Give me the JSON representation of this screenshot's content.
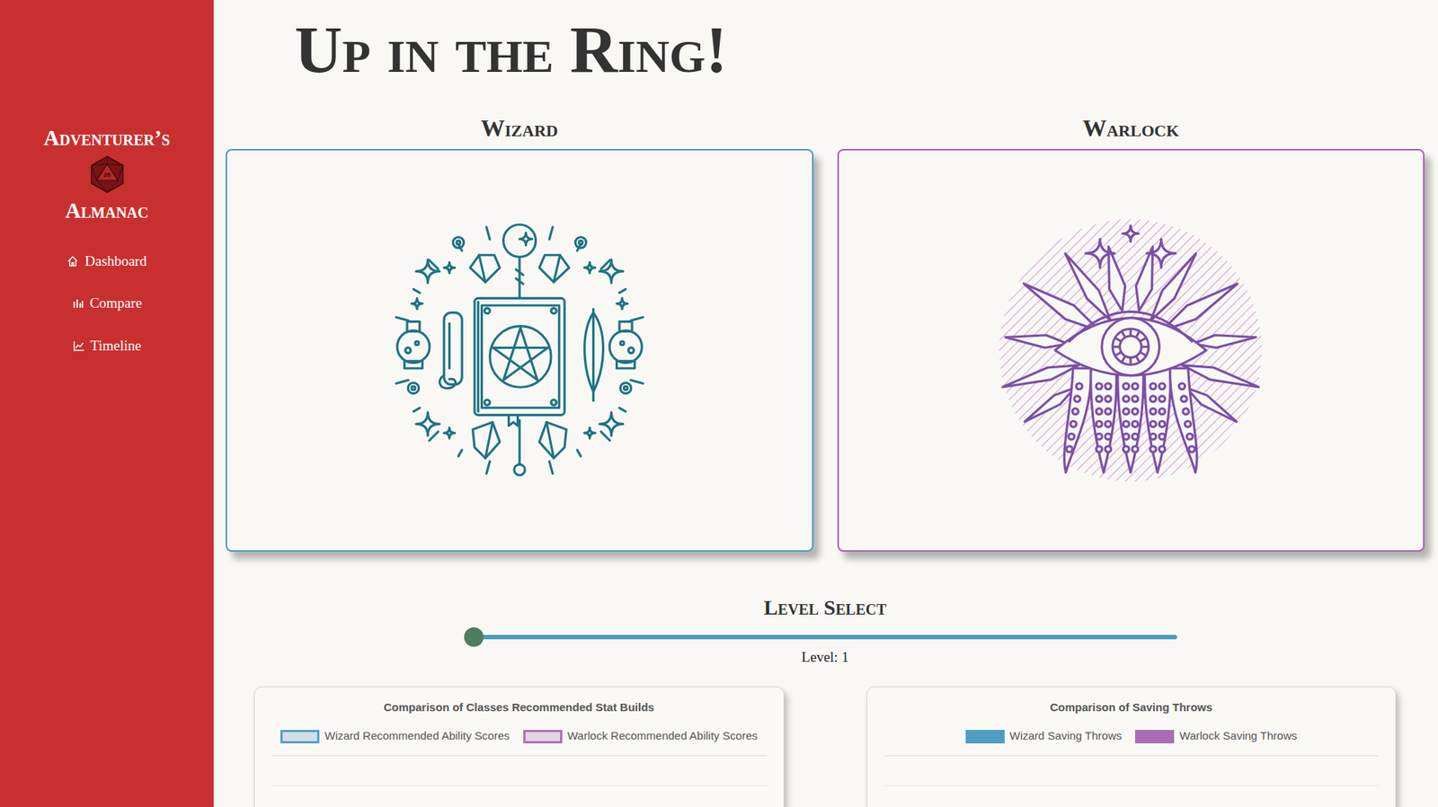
{
  "sidebar": {
    "brand_top": "Adventurer’s",
    "die_label": "20",
    "brand_bottom": "Almanac",
    "items": [
      {
        "label": "Dashboard"
      },
      {
        "label": "Compare"
      },
      {
        "label": "Timeline"
      }
    ]
  },
  "page": {
    "title": "Up in the Ring!"
  },
  "classes": [
    {
      "name": "Wizard",
      "color": "#4a9bbf"
    },
    {
      "name": "Warlock",
      "color": "#a760b0"
    }
  ],
  "level_select": {
    "title": "Level Select",
    "level": 0,
    "reading": "Level: 1"
  },
  "charts": [
    {
      "title": "Comparison of Classes Recommended Stat Builds",
      "kind": "outline",
      "legend": [
        {
          "label": "Wizard Recommended Ability Scores",
          "color": "#5b9ec6"
        },
        {
          "label": "Warlock Recommended Ability Scores",
          "color": "#b070b8"
        }
      ]
    },
    {
      "title": "Comparison of Saving Throws",
      "kind": "solid",
      "legend": [
        {
          "label": "Wizard Saving Throws",
          "color": "#4e9ec4"
        },
        {
          "label": "Warlock Saving Throws",
          "color": "#a86eb5"
        }
      ]
    }
  ]
}
